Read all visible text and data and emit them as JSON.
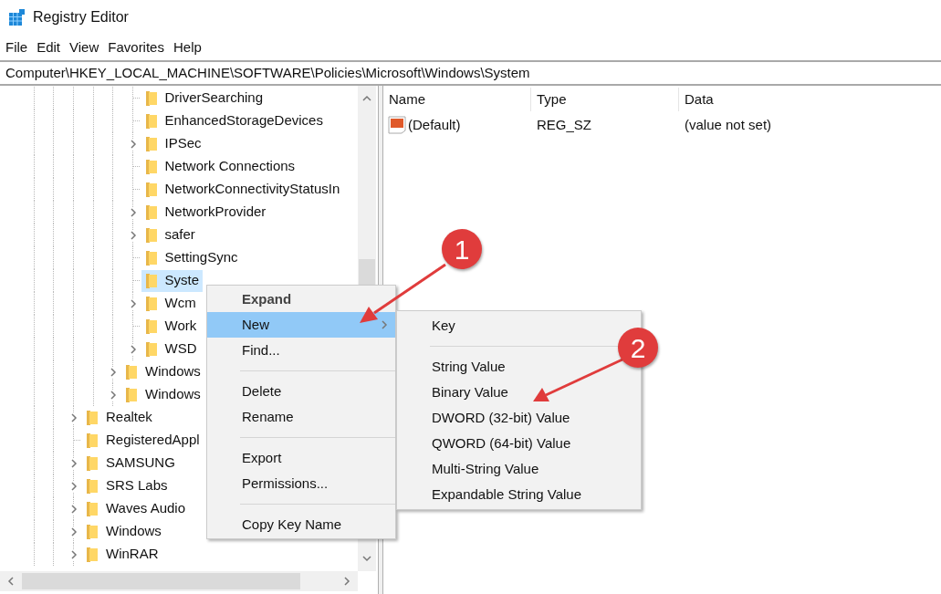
{
  "window": {
    "title": "Registry Editor"
  },
  "menu_bar": [
    "File",
    "Edit",
    "View",
    "Favorites",
    "Help"
  ],
  "address_bar": {
    "value": "Computer\\HKEY_LOCAL_MACHINE\\SOFTWARE\\Policies\\Microsoft\\Windows\\System"
  },
  "tree": {
    "items": [
      {
        "children": [
          {
            "children": [
              {
                "children": [
                  {
                    "label": "DriverSearching",
                    "expandable": false,
                    "selected": false
                  },
                  {
                    "label": "EnhancedStorageDevices",
                    "expandable": false,
                    "selected": false
                  },
                  {
                    "label": "IPSec",
                    "expandable": true,
                    "selected": false
                  },
                  {
                    "label": "Network Connections",
                    "expandable": false,
                    "selected": false
                  },
                  {
                    "label": "NetworkConnectivityStatusIn",
                    "expandable": false,
                    "selected": false
                  },
                  {
                    "label": "NetworkProvider",
                    "expandable": true,
                    "selected": false
                  },
                  {
                    "label": "safer",
                    "expandable": true,
                    "selected": false
                  },
                  {
                    "label": "SettingSync",
                    "expandable": false,
                    "selected": false
                  },
                  {
                    "label": "Syste",
                    "expandable": false,
                    "selected": true
                  },
                  {
                    "label": "Wcm",
                    "expandable": true,
                    "selected": false
                  },
                  {
                    "label": "Work",
                    "expandable": false,
                    "selected": false
                  },
                  {
                    "label": "WSD",
                    "expandable": true,
                    "selected": false
                  }
                ]
              },
              {
                "label": "Windows",
                "expandable": true,
                "selected": false
              },
              {
                "label": "Windows",
                "expandable": true,
                "selected": false
              }
            ]
          }
        ]
      },
      {
        "label": "Realtek",
        "expandable": true,
        "selected": false
      },
      {
        "label": "RegisteredAppl",
        "expandable": false,
        "selected": false
      },
      {
        "label": "SAMSUNG",
        "expandable": true,
        "selected": false
      },
      {
        "label": "SRS Labs",
        "expandable": true,
        "selected": false
      },
      {
        "label": "Waves Audio",
        "expandable": true,
        "selected": false
      },
      {
        "label": "Windows",
        "expandable": true,
        "selected": false
      },
      {
        "label": "WinRAR",
        "expandable": true,
        "selected": false
      }
    ]
  },
  "values_table": {
    "columns": [
      "Name",
      "Type",
      "Data"
    ],
    "rows": [
      {
        "name": "(Default)",
        "type": "REG_SZ",
        "data": "(value not set)"
      }
    ]
  },
  "context_menu": {
    "items": [
      {
        "kind": "item",
        "label": "Expand",
        "bold": true,
        "selected": false,
        "submenu": false
      },
      {
        "kind": "item",
        "label": "New",
        "bold": false,
        "selected": true,
        "submenu": true
      },
      {
        "kind": "item",
        "label": "Find...",
        "bold": false,
        "selected": false,
        "submenu": false
      },
      {
        "kind": "separator"
      },
      {
        "kind": "item",
        "label": "Delete",
        "bold": false,
        "selected": false,
        "submenu": false
      },
      {
        "kind": "item",
        "label": "Rename",
        "bold": false,
        "selected": false,
        "submenu": false
      },
      {
        "kind": "separator"
      },
      {
        "kind": "item",
        "label": "Export",
        "bold": false,
        "selected": false,
        "submenu": false
      },
      {
        "kind": "item",
        "label": "Permissions...",
        "bold": false,
        "selected": false,
        "submenu": false
      },
      {
        "kind": "separator"
      },
      {
        "kind": "item",
        "label": "Copy Key Name",
        "bold": false,
        "selected": false,
        "submenu": false
      }
    ]
  },
  "submenu": {
    "items": [
      {
        "kind": "item",
        "label": "Key"
      },
      {
        "kind": "separator"
      },
      {
        "kind": "item",
        "label": "String Value"
      },
      {
        "kind": "item",
        "label": "Binary Value"
      },
      {
        "kind": "item",
        "label": "DWORD (32-bit) Value"
      },
      {
        "kind": "item",
        "label": "QWORD (64-bit) Value"
      },
      {
        "kind": "item",
        "label": "Multi-String Value"
      },
      {
        "kind": "item",
        "label": "Expandable String Value"
      }
    ]
  },
  "annotations": [
    {
      "label": "1"
    },
    {
      "label": "2"
    }
  ]
}
